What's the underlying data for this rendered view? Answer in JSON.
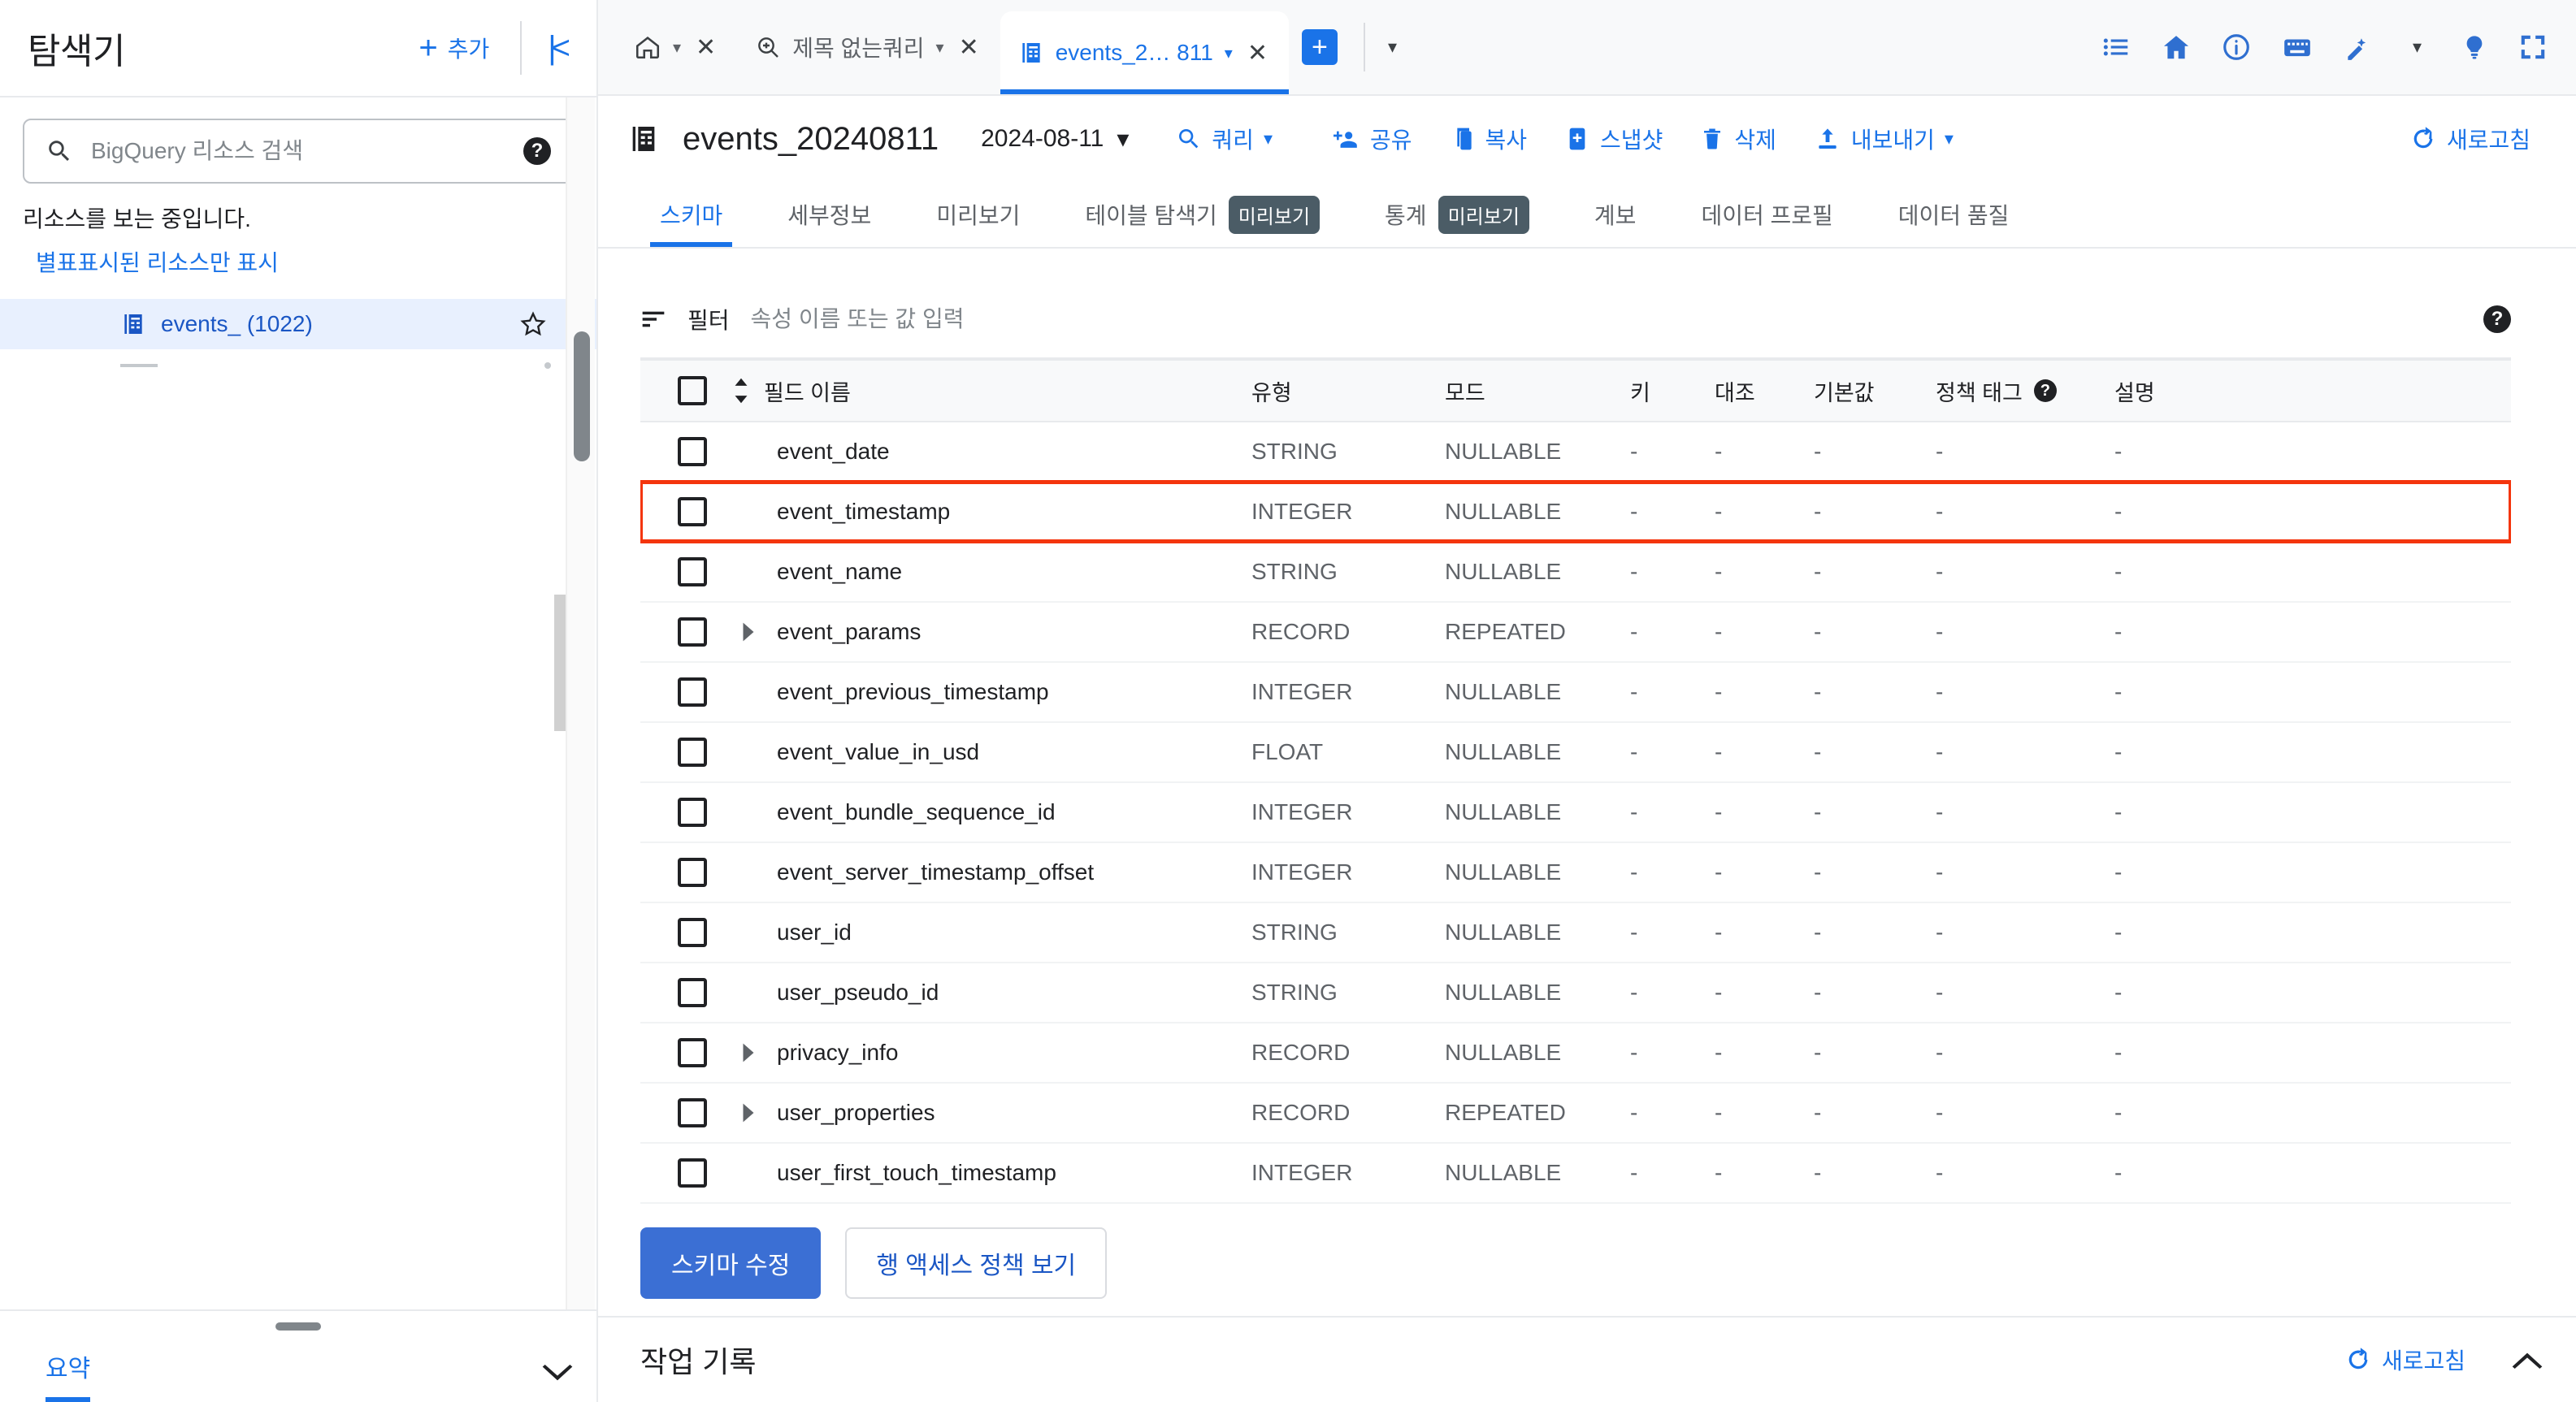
{
  "sidebar": {
    "title": "탐색기",
    "add_label": "추가",
    "search_placeholder": "BigQuery 리소스 검색",
    "search_value": "",
    "note": "리소스를 보는 중입니다.",
    "starred_link": "별표표시된 리소스만 표시",
    "tree_items": [
      {
        "label": "events_ (1022)",
        "icon": "table-icon",
        "selected": true
      }
    ],
    "footer_tab": "요약"
  },
  "tabstrip": {
    "tabs": [
      {
        "label": "",
        "icon": "home-icon",
        "active": false,
        "has_caret": true,
        "closable": true
      },
      {
        "label": "제목 없는쿼리",
        "icon": "query-icon",
        "active": false,
        "has_caret": true,
        "closable": true
      },
      {
        "label": "events_2… 811",
        "icon": "table-icon",
        "active": true,
        "has_caret": true,
        "closable": true
      }
    ],
    "new_tab_label": "+",
    "right_icons": [
      "list-icon",
      "home-icon",
      "info-icon",
      "keyboard-icon",
      "magic-pen-icon",
      "lightbulb-icon",
      "fullscreen-icon"
    ]
  },
  "header": {
    "table_icon": "table-icon",
    "title": "events_20240811",
    "date_selector": "2024-08-11",
    "query_button": "쿼리",
    "actions": [
      {
        "label": "공유",
        "icon": "share-icon"
      },
      {
        "label": "복사",
        "icon": "copy-icon"
      },
      {
        "label": "스냅샷",
        "icon": "snapshot-icon"
      },
      {
        "label": "삭제",
        "icon": "trash-icon"
      },
      {
        "label": "내보내기",
        "icon": "export-icon",
        "has_caret": true
      }
    ],
    "refresh_label": "새로고침"
  },
  "subtabs": [
    {
      "label": "스키마",
      "active": true,
      "badge": ""
    },
    {
      "label": "세부정보",
      "active": false,
      "badge": ""
    },
    {
      "label": "미리보기",
      "active": false,
      "badge": ""
    },
    {
      "label": "테이블 탐색기",
      "active": false,
      "badge": "미리보기"
    },
    {
      "label": "통계",
      "active": false,
      "badge": "미리보기"
    },
    {
      "label": "계보",
      "active": false,
      "badge": ""
    },
    {
      "label": "데이터 프로필",
      "active": false,
      "badge": ""
    },
    {
      "label": "데이터 품질",
      "active": false,
      "badge": ""
    }
  ],
  "filter": {
    "label": "필터",
    "placeholder": "속성 이름 또는 값 입력",
    "value": ""
  },
  "schema_table": {
    "columns": [
      "필드 이름",
      "유형",
      "모드",
      "키",
      "대조",
      "기본값",
      "정책 태그",
      "설명"
    ],
    "rows": [
      {
        "name": "event_date",
        "type": "STRING",
        "mode": "NULLABLE",
        "key": "-",
        "collation": "-",
        "default": "-",
        "policy_tag": "-",
        "description": "-",
        "expandable": false,
        "highlighted": false
      },
      {
        "name": "event_timestamp",
        "type": "INTEGER",
        "mode": "NULLABLE",
        "key": "-",
        "collation": "-",
        "default": "-",
        "policy_tag": "-",
        "description": "-",
        "expandable": false,
        "highlighted": true
      },
      {
        "name": "event_name",
        "type": "STRING",
        "mode": "NULLABLE",
        "key": "-",
        "collation": "-",
        "default": "-",
        "policy_tag": "-",
        "description": "-",
        "expandable": false,
        "highlighted": false
      },
      {
        "name": "event_params",
        "type": "RECORD",
        "mode": "REPEATED",
        "key": "-",
        "collation": "-",
        "default": "-",
        "policy_tag": "-",
        "description": "-",
        "expandable": true,
        "highlighted": false
      },
      {
        "name": "event_previous_timestamp",
        "type": "INTEGER",
        "mode": "NULLABLE",
        "key": "-",
        "collation": "-",
        "default": "-",
        "policy_tag": "-",
        "description": "-",
        "expandable": false,
        "highlighted": false
      },
      {
        "name": "event_value_in_usd",
        "type": "FLOAT",
        "mode": "NULLABLE",
        "key": "-",
        "collation": "-",
        "default": "-",
        "policy_tag": "-",
        "description": "-",
        "expandable": false,
        "highlighted": false
      },
      {
        "name": "event_bundle_sequence_id",
        "type": "INTEGER",
        "mode": "NULLABLE",
        "key": "-",
        "collation": "-",
        "default": "-",
        "policy_tag": "-",
        "description": "-",
        "expandable": false,
        "highlighted": false
      },
      {
        "name": "event_server_timestamp_offset",
        "type": "INTEGER",
        "mode": "NULLABLE",
        "key": "-",
        "collation": "-",
        "default": "-",
        "policy_tag": "-",
        "description": "-",
        "expandable": false,
        "highlighted": false
      },
      {
        "name": "user_id",
        "type": "STRING",
        "mode": "NULLABLE",
        "key": "-",
        "collation": "-",
        "default": "-",
        "policy_tag": "-",
        "description": "-",
        "expandable": false,
        "highlighted": false
      },
      {
        "name": "user_pseudo_id",
        "type": "STRING",
        "mode": "NULLABLE",
        "key": "-",
        "collation": "-",
        "default": "-",
        "policy_tag": "-",
        "description": "-",
        "expandable": false,
        "highlighted": false
      },
      {
        "name": "privacy_info",
        "type": "RECORD",
        "mode": "NULLABLE",
        "key": "-",
        "collation": "-",
        "default": "-",
        "policy_tag": "-",
        "description": "-",
        "expandable": true,
        "highlighted": false
      },
      {
        "name": "user_properties",
        "type": "RECORD",
        "mode": "REPEATED",
        "key": "-",
        "collation": "-",
        "default": "-",
        "policy_tag": "-",
        "description": "-",
        "expandable": true,
        "highlighted": false
      },
      {
        "name": "user_first_touch_timestamp",
        "type": "INTEGER",
        "mode": "NULLABLE",
        "key": "-",
        "collation": "-",
        "default": "-",
        "policy_tag": "-",
        "description": "-",
        "expandable": false,
        "highlighted": false
      }
    ]
  },
  "footer_buttons": {
    "primary": "스키마 수정",
    "secondary": "행 액세스 정책 보기"
  },
  "jobbar": {
    "title": "작업 기록",
    "refresh_label": "새로고침"
  },
  "colors": {
    "accent": "#1a73e8",
    "highlight": "#f4350d",
    "badge_bg": "#4b5c66",
    "selected_row_bg": "#e8f0fe"
  }
}
